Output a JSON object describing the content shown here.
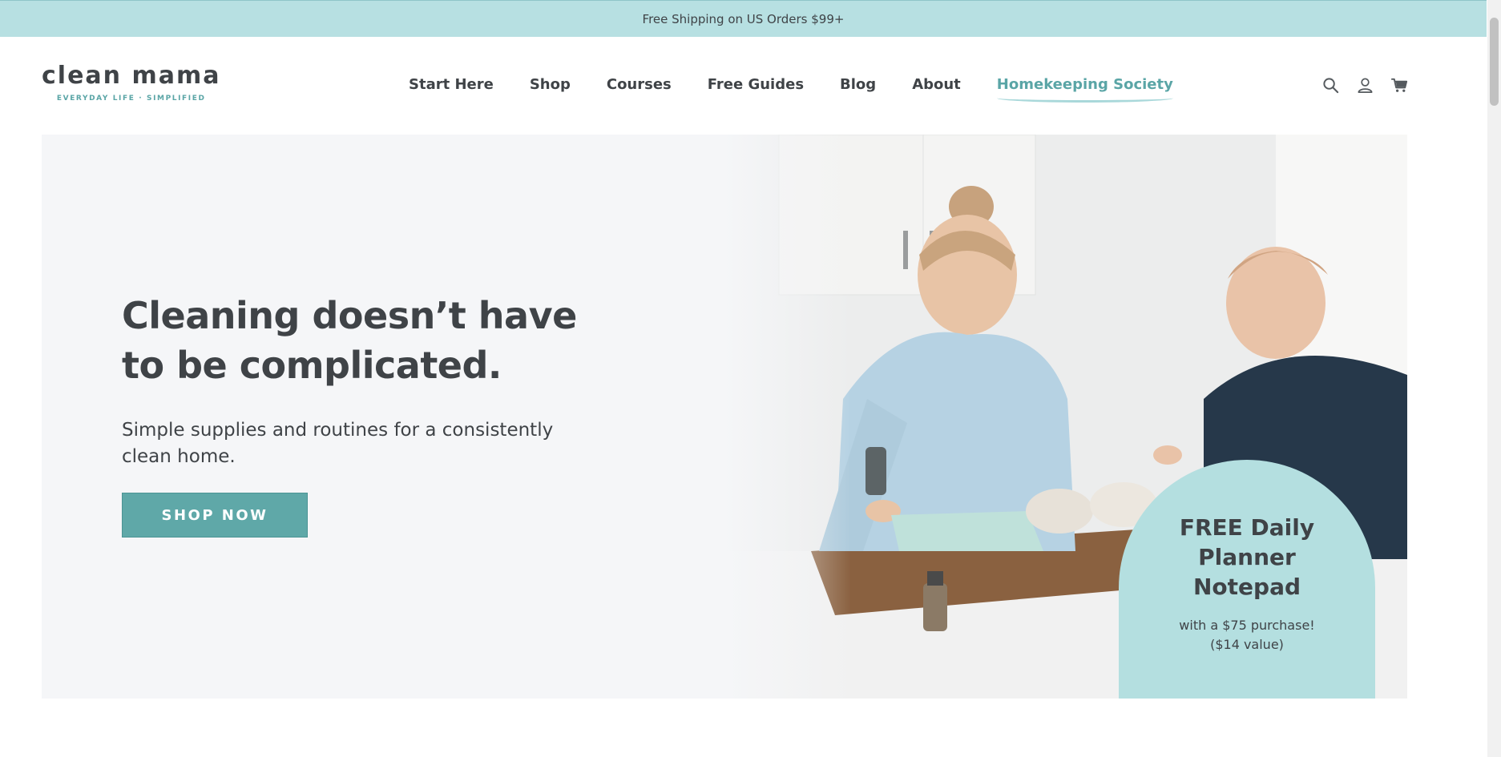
{
  "announcement": {
    "text": "Free Shipping on US Orders $99+"
  },
  "brand": {
    "name": "clean mama",
    "tagline": "EVERYDAY LIFE · SIMPLIFIED"
  },
  "nav": {
    "items": [
      {
        "label": "Start Here"
      },
      {
        "label": "Shop"
      },
      {
        "label": "Courses"
      },
      {
        "label": "Free Guides"
      },
      {
        "label": "Blog"
      },
      {
        "label": "About"
      },
      {
        "label": "Homekeeping Society"
      }
    ],
    "active": "Homekeeping Society"
  },
  "header_icons": [
    "search-icon",
    "account-icon",
    "cart-icon"
  ],
  "hero": {
    "title_line1": "Cleaning doesn’t have",
    "title_line2": "to be complicated.",
    "subtitle": "Simple supplies and routines for a consistently clean home.",
    "cta": "SHOP NOW"
  },
  "promo": {
    "title_line1": "FREE Daily",
    "title_line2": "Planner",
    "title_line3": "Notepad",
    "sub_line1": "with a $75 purchase!",
    "sub_line2": "($14 value)"
  },
  "colors": {
    "announcement_bg": "#b7e0e2",
    "accent": "#5fa8a8",
    "text": "#3f4347",
    "hero_bg": "#f5f6f8",
    "promo_bg": "#b4dfe0"
  }
}
